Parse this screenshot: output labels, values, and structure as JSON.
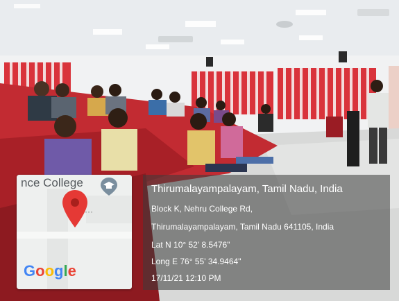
{
  "map": {
    "place_label": "nce College",
    "logo_text": "Google",
    "logo_colors": [
      "#4285F4",
      "#EA4335",
      "#FBBC05",
      "#4285F4",
      "#34A853",
      "#EA4335"
    ],
    "pin_color": "#E53935",
    "pin_icon": "map-pin-icon",
    "graduation_icon": "graduation-cap-icon"
  },
  "location": {
    "title": "Thirumalayampalayam, Tamil Nadu, India",
    "address_line1": "Block K, Nehru College Rd,",
    "address_line2": "Thirumalayampalayam, Tamil Nadu 641105, India",
    "latitude": "Lat N 10° 52' 8.5476\"",
    "longitude": "Long E 76° 55' 34.9464\"",
    "timestamp": "17/11/21 12:10 PM"
  }
}
